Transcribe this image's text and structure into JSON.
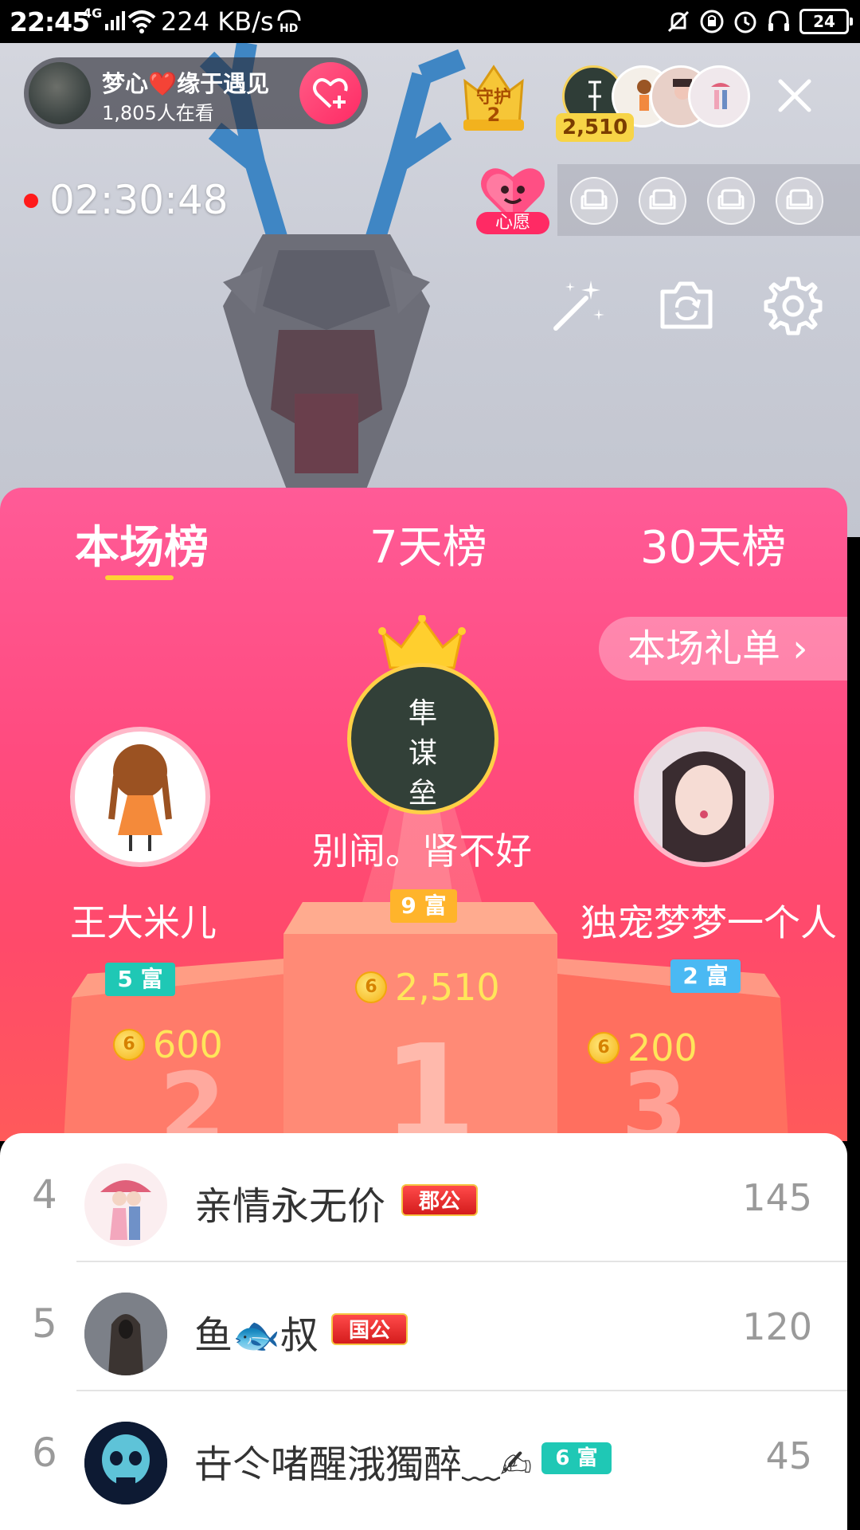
{
  "status_bar": {
    "time": "22:45",
    "network": "4G",
    "speed": "224 KB/s",
    "battery": "24"
  },
  "anchor": {
    "name": "梦心❤️缘于遇见",
    "viewers": "1,805人在看"
  },
  "guard": {
    "label": "守护",
    "count": "2"
  },
  "top_viewer_score": "2,510",
  "timer": "02:30:48",
  "wish_label": "心愿",
  "tabs": [
    {
      "label": "本场榜"
    },
    {
      "label": "7天榜"
    },
    {
      "label": "30天榜"
    }
  ],
  "gift_list_button": "本场礼单 ›",
  "podium": {
    "first": {
      "name": "别闹。肾不好",
      "fortune": "9 富",
      "score": "2,510",
      "avatar_text": "隼\n谋\n垒"
    },
    "second": {
      "name": "王大米儿",
      "fortune": "5 富",
      "score": "600"
    },
    "third": {
      "name": "独宠梦梦一个人",
      "fortune": "2 富",
      "score": "200"
    }
  },
  "list": [
    {
      "rank": "4",
      "name": "亲情永无价",
      "badge": "郡公",
      "score": "145"
    },
    {
      "rank": "5",
      "name": "鱼🐟叔",
      "badge": "国公",
      "score": "120"
    },
    {
      "rank": "6",
      "name": "卋仒啫醒涐獨醉﹏✍",
      "badge": "6 富",
      "score": "45"
    }
  ],
  "coin_symbol": "6",
  "colors": {
    "panel_pink": "#ff5b97",
    "accent_gold": "#ffd234",
    "fortune_orange": "#ffb42b",
    "fortune_teal": "#1fc8b5",
    "fortune_blue": "#4ab9f3"
  }
}
